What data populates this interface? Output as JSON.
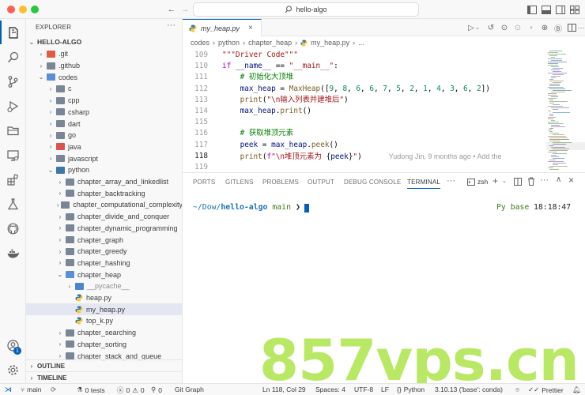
{
  "window": {
    "title": "hello-algo"
  },
  "activity": {
    "items": [
      "explorer-icon",
      "search-icon",
      "source-control-icon",
      "run-debug-icon",
      "remote-explorer-icon",
      "extensions-icon",
      "testing-icon",
      "github-icon",
      "docker-icon"
    ],
    "account_badge": "1"
  },
  "sidebar": {
    "title": "EXPLORER",
    "root": "HELLO-ALGO",
    "tree": [
      {
        "label": ".git",
        "depth": 1,
        "kind": "folder-git",
        "open": false
      },
      {
        "label": ".github",
        "depth": 1,
        "kind": "folder",
        "open": false
      },
      {
        "label": "codes",
        "depth": 1,
        "kind": "folder",
        "open": true
      },
      {
        "label": "c",
        "depth": 2,
        "kind": "folder",
        "open": false
      },
      {
        "label": "cpp",
        "depth": 2,
        "kind": "folder",
        "open": false
      },
      {
        "label": "csharp",
        "depth": 2,
        "kind": "folder",
        "open": false
      },
      {
        "label": "dart",
        "depth": 2,
        "kind": "folder",
        "open": false
      },
      {
        "label": "go",
        "depth": 2,
        "kind": "folder",
        "open": false
      },
      {
        "label": "java",
        "depth": 2,
        "kind": "folder-java",
        "open": false
      },
      {
        "label": "javascript",
        "depth": 2,
        "kind": "folder",
        "open": false
      },
      {
        "label": "python",
        "depth": 2,
        "kind": "folder-python",
        "open": true
      },
      {
        "label": "chapter_array_and_linkedlist",
        "depth": 3,
        "kind": "folder",
        "open": false
      },
      {
        "label": "chapter_backtracking",
        "depth": 3,
        "kind": "folder",
        "open": false
      },
      {
        "label": "chapter_computational_complexity",
        "depth": 3,
        "kind": "folder",
        "open": false
      },
      {
        "label": "chapter_divide_and_conquer",
        "depth": 3,
        "kind": "folder",
        "open": false
      },
      {
        "label": "chapter_dynamic_programming",
        "depth": 3,
        "kind": "folder",
        "open": false
      },
      {
        "label": "chapter_graph",
        "depth": 3,
        "kind": "folder",
        "open": false
      },
      {
        "label": "chapter_greedy",
        "depth": 3,
        "kind": "folder",
        "open": false
      },
      {
        "label": "chapter_hashing",
        "depth": 3,
        "kind": "folder",
        "open": false
      },
      {
        "label": "chapter_heap",
        "depth": 3,
        "kind": "folder",
        "open": true
      },
      {
        "label": "__pycache__",
        "depth": 4,
        "kind": "folder-pycache",
        "open": false
      },
      {
        "label": "heap.py",
        "depth": 4,
        "kind": "py"
      },
      {
        "label": "my_heap.py",
        "depth": 4,
        "kind": "py",
        "selected": true
      },
      {
        "label": "top_k.py",
        "depth": 4,
        "kind": "py"
      },
      {
        "label": "chapter_searching",
        "depth": 3,
        "kind": "folder",
        "open": false
      },
      {
        "label": "chapter_sorting",
        "depth": 3,
        "kind": "folder",
        "open": false
      },
      {
        "label": "chapter_stack_and_queue",
        "depth": 3,
        "kind": "folder",
        "open": false
      }
    ],
    "outline": "OUTLINE",
    "timeline": "TIMELINE"
  },
  "editor": {
    "tab_label": "my_heap.py",
    "breadcrumb": [
      "codes",
      "python",
      "chapter_heap",
      "my_heap.py",
      "..."
    ],
    "lines": [
      {
        "n": "109",
        "tokens": [
          [
            "str",
            "\"\"\"Driver Code\"\"\""
          ]
        ]
      },
      {
        "n": "110",
        "tokens": [
          [
            "kw",
            "if "
          ],
          [
            "var",
            "__name__"
          ],
          [
            "op",
            " == "
          ],
          [
            "str",
            "\"__main__\""
          ],
          [
            "op",
            ":"
          ]
        ]
      },
      {
        "n": "111",
        "tokens": [
          [
            "op",
            "    "
          ],
          [
            "cmt",
            "# 初始化大顶堆"
          ]
        ]
      },
      {
        "n": "112",
        "tokens": [
          [
            "op",
            "    "
          ],
          [
            "var",
            "max_heap"
          ],
          [
            "op",
            " = "
          ],
          [
            "fn",
            "MaxHeap"
          ],
          [
            "op",
            "(["
          ],
          [
            "num",
            "9"
          ],
          [
            "op",
            ", "
          ],
          [
            "num",
            "8"
          ],
          [
            "op",
            ", "
          ],
          [
            "num",
            "6"
          ],
          [
            "op",
            ", "
          ],
          [
            "num",
            "6"
          ],
          [
            "op",
            ", "
          ],
          [
            "num",
            "7"
          ],
          [
            "op",
            ", "
          ],
          [
            "num",
            "5"
          ],
          [
            "op",
            ", "
          ],
          [
            "num",
            "2"
          ],
          [
            "op",
            ", "
          ],
          [
            "num",
            "1"
          ],
          [
            "op",
            ", "
          ],
          [
            "num",
            "4"
          ],
          [
            "op",
            ", "
          ],
          [
            "num",
            "3"
          ],
          [
            "op",
            ", "
          ],
          [
            "num",
            "6"
          ],
          [
            "op",
            ", "
          ],
          [
            "num",
            "2"
          ],
          [
            "op",
            "])"
          ]
        ]
      },
      {
        "n": "113",
        "tokens": [
          [
            "op",
            "    "
          ],
          [
            "fn",
            "print"
          ],
          [
            "op",
            "("
          ],
          [
            "str",
            "\"\\n输入列表并建堆后\""
          ],
          [
            "op",
            ")"
          ]
        ]
      },
      {
        "n": "114",
        "tokens": [
          [
            "op",
            "    "
          ],
          [
            "var",
            "max_heap"
          ],
          [
            "op",
            "."
          ],
          [
            "fn",
            "print"
          ],
          [
            "op",
            "()"
          ]
        ]
      },
      {
        "n": "115",
        "tokens": []
      },
      {
        "n": "116",
        "tokens": [
          [
            "op",
            "    "
          ],
          [
            "cmt",
            "# 获取堆顶元素"
          ]
        ]
      },
      {
        "n": "117",
        "tokens": [
          [
            "op",
            "    "
          ],
          [
            "var",
            "peek"
          ],
          [
            "op",
            " = "
          ],
          [
            "var",
            "max_heap"
          ],
          [
            "op",
            "."
          ],
          [
            "fn",
            "peek"
          ],
          [
            "op",
            "()"
          ]
        ]
      },
      {
        "n": "118",
        "tokens": [
          [
            "op",
            "    "
          ],
          [
            "fn",
            "print"
          ],
          [
            "op",
            "("
          ],
          [
            "kw",
            "f"
          ],
          [
            "str",
            "\"\\n堆顶元素为 "
          ],
          [
            "op",
            "{"
          ],
          [
            "var",
            "peek"
          ],
          [
            "op",
            "}"
          ],
          [
            "str",
            "\""
          ],
          [
            "op",
            ")"
          ]
        ],
        "current": true,
        "blame": "Yudong Jin, 9 months ago • Add the"
      },
      {
        "n": "119",
        "tokens": []
      }
    ]
  },
  "panel": {
    "tabs": [
      "PORTS",
      "GITLENS",
      "PROBLEMS",
      "OUTPUT",
      "DEBUG CONSOLE",
      "TERMINAL"
    ],
    "active_tab": "TERMINAL",
    "more": "···",
    "shell": "zsh",
    "prompt_path": "~/Dow/",
    "prompt_repo": "hello-algo",
    "prompt_branch": "main",
    "prompt_arrow": "❯",
    "right_env": "Py base",
    "right_time": "18:18:47"
  },
  "status": {
    "branch": "main",
    "tests": "0 tests",
    "errors": "0",
    "warnings": "0",
    "ports": "0",
    "git_graph": "Git Graph",
    "cursor": "Ln 118, Col 29",
    "spaces": "Spaces: 4",
    "encoding": "UTF-8",
    "eol": "LF",
    "language": "Python",
    "interpreter": "3.10.13 ('base': conda)",
    "prettier": "Prettier"
  },
  "watermark": "857vps.cn",
  "colors": {
    "accent": "#005fb8",
    "watermark": "#a6e23a",
    "selected_row": "#e4e6f1"
  }
}
